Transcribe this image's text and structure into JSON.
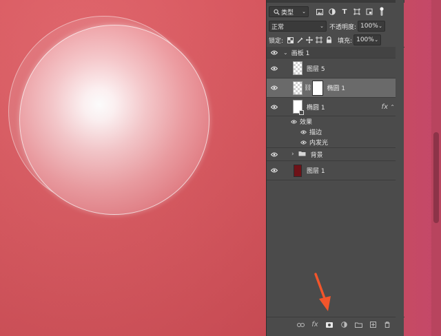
{
  "panel": {
    "filter": {
      "label": "类型",
      "icons": [
        "image-filter-icon",
        "adjustment-filter-icon",
        "type-filter-icon",
        "shape-filter-icon",
        "smart-object-filter-icon",
        "filter-toggle-icon"
      ]
    },
    "blend_mode": "正常",
    "opacity_label": "不透明度:",
    "opacity_value": "100%",
    "lock_label": "锁定:",
    "fill_label": "填充:",
    "fill_value": "100%"
  },
  "layers": [
    {
      "name": "画板 1",
      "type": "artboard",
      "visible": true
    },
    {
      "name": "图层 5",
      "type": "layer",
      "visible": true
    },
    {
      "name": "椭圆 1",
      "type": "shape-with-mask",
      "visible": true,
      "selected": true
    },
    {
      "name": "椭圆 1",
      "type": "shape",
      "visible": true,
      "has_fx": true,
      "fx_label": "fx"
    },
    {
      "name": "效果",
      "type": "effects-group",
      "visible": true
    },
    {
      "name": "描边",
      "type": "effect",
      "visible": true
    },
    {
      "name": "内发光",
      "type": "effect",
      "visible": true
    },
    {
      "name": "背景",
      "type": "group",
      "visible": true
    },
    {
      "name": "图层 1",
      "type": "layer",
      "visible": true
    }
  ],
  "bottom_bar": {
    "fx_label": "fx",
    "icons": [
      "link-layers-icon",
      "add-style-icon",
      "add-mask-icon",
      "new-adjustment-icon",
      "new-group-icon",
      "new-layer-icon",
      "delete-layer-icon"
    ]
  },
  "colors": {
    "canvas": "#d9565e",
    "panel": "#4b4b4b",
    "selected_row": "#6a6a6a",
    "arrow": "#f2552b"
  }
}
